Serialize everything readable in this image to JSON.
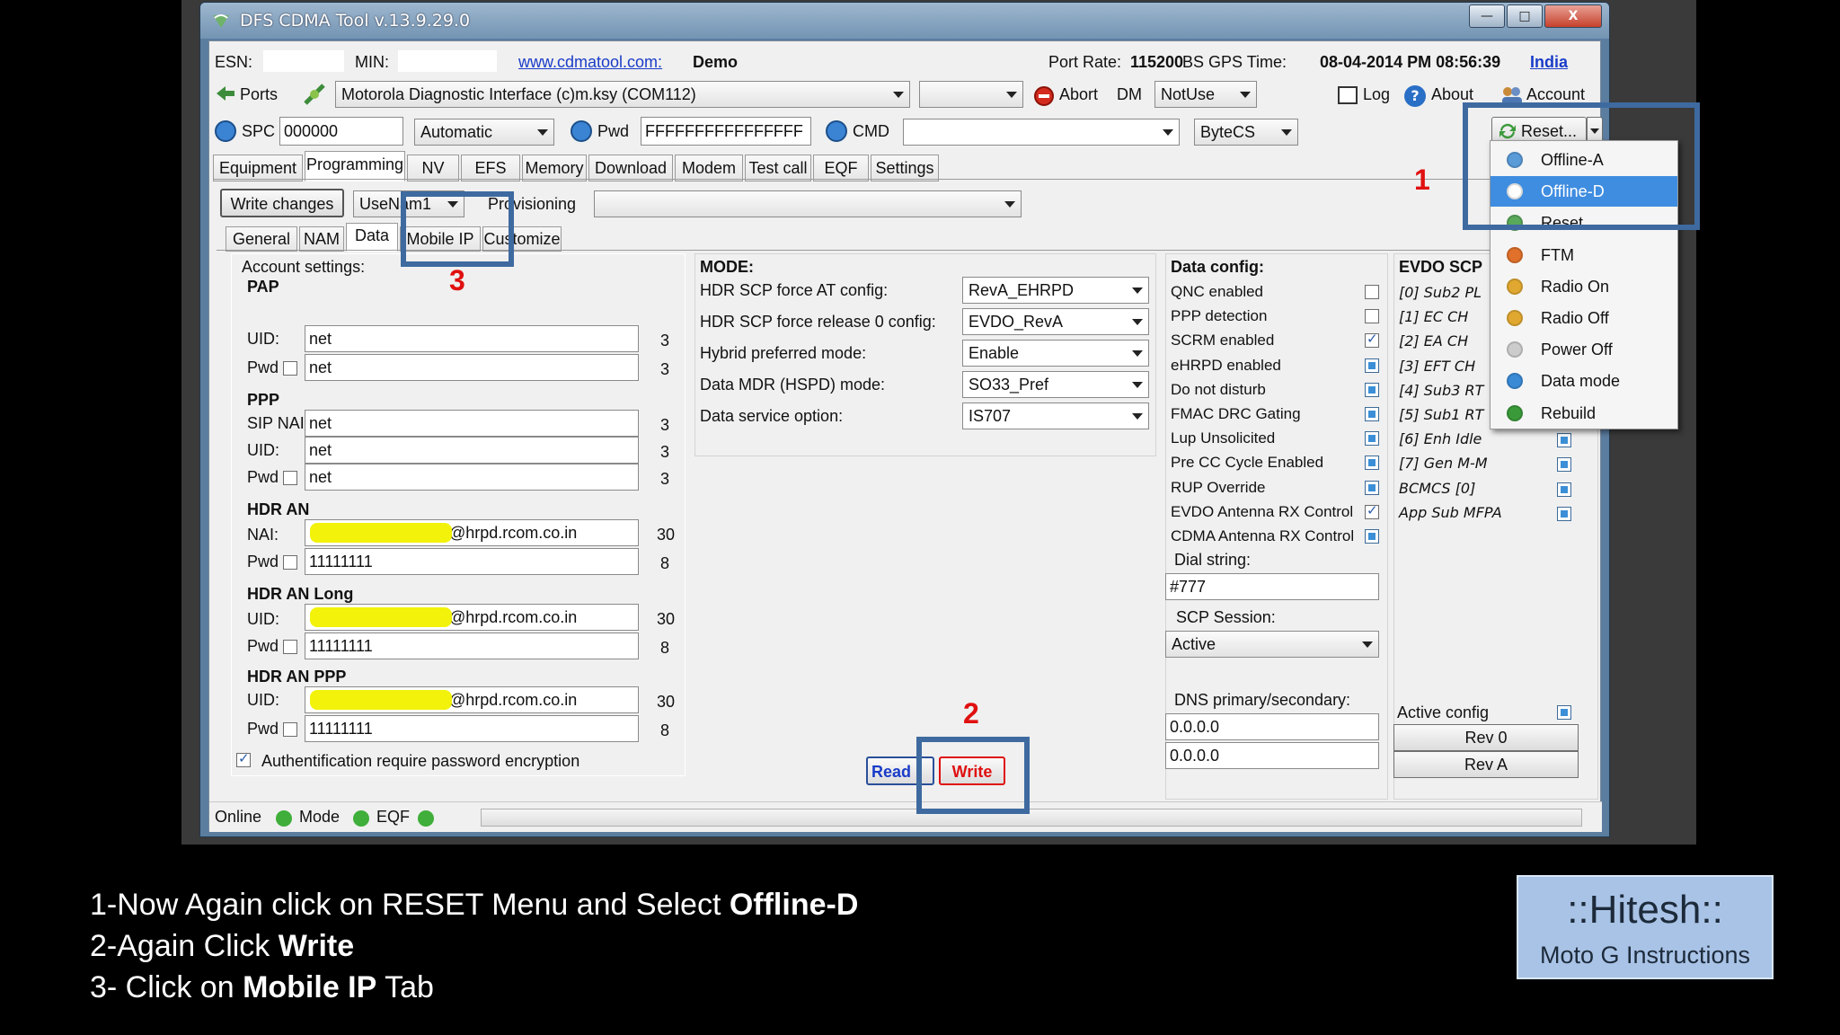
{
  "window": {
    "title": "DFS CDMA Tool v.13.9.29.0",
    "minimize": "—",
    "maximize": "□",
    "close": "X"
  },
  "info": {
    "esn_label": "ESN:",
    "esn_value": "",
    "min_label": "MIN:",
    "min_value": "",
    "link": "www.cdmatool.com:",
    "mode": "Demo",
    "port_rate_label": "Port Rate:",
    "port_rate": "115200",
    "gps_label": "BS GPS Time:",
    "gps_time": "08-04-2014 PM 08:56:39",
    "region": "India"
  },
  "toolbar1": {
    "ports": "Ports",
    "port_select": "Motorola Diagnostic Interface (c)m.ksy (COM112)",
    "second_select": "",
    "abort": "Abort",
    "dm_label": "DM",
    "dm_select": "NotUse",
    "log": "Log",
    "about": "About",
    "account": "Account"
  },
  "toolbar2": {
    "spc_label": "SPC",
    "spc_value": "000000",
    "spc_mode": "Automatic",
    "pwd_label": "Pwd",
    "pwd_value": "FFFFFFFFFFFFFFFF",
    "cmd_label": "CMD",
    "cmd_value": "",
    "bytecs": "ByteCS",
    "reset": "Reset..."
  },
  "main_tabs": [
    "Equipment",
    "Programming",
    "NV",
    "EFS",
    "Memory",
    "Download",
    "Modem",
    "Test call",
    "EQF",
    "Settings"
  ],
  "prog": {
    "write_changes": "Write changes",
    "usenam": "UseNam1",
    "provisioning_label": "Provisioning",
    "provisioning_value": ""
  },
  "sub_tabs": [
    "General",
    "NAM",
    "Data",
    "Mobile IP",
    "Customize"
  ],
  "account": {
    "heading": "Account settings:",
    "pap": {
      "title": "PAP",
      "uid_label": "UID:",
      "uid": "net",
      "uid_len": "3",
      "pwd_label": "Pwd",
      "pwd": "net",
      "pwd_len": "3"
    },
    "ppp": {
      "title": "PPP",
      "sip_label": "SIP NAI",
      "sip": "net",
      "sip_len": "3",
      "uid_label": "UID:",
      "uid": "net",
      "uid_len": "3",
      "pwd_label": "Pwd",
      "pwd": "net",
      "pwd_len": "3"
    },
    "hdr_an": {
      "title": "HDR AN",
      "nai_label": "NAI:",
      "nai": "@hrpd.rcom.co.in",
      "nai_len": "30",
      "pwd_label": "Pwd",
      "pwd": "11111111",
      "pwd_len": "8"
    },
    "hdr_an_long": {
      "title": "HDR AN Long",
      "uid_label": "UID:",
      "uid": "@hrpd.rcom.co.in",
      "uid_len": "30",
      "pwd_label": "Pwd",
      "pwd": "11111111",
      "pwd_len": "8"
    },
    "hdr_an_ppp": {
      "title": "HDR AN PPP",
      "uid_label": "UID:",
      "uid": "@hrpd.rcom.co.in",
      "uid_len": "30",
      "pwd_label": "Pwd",
      "pwd": "11111111",
      "pwd_len": "8"
    },
    "auth": "Authentification require password encryption"
  },
  "mode": {
    "title": "MODE:",
    "rows": [
      {
        "label": "HDR SCP force AT config:",
        "value": "RevA_EHRPD"
      },
      {
        "label": "HDR SCP force release 0 config:",
        "value": "EVDO_RevA"
      },
      {
        "label": "Hybrid preferred mode:",
        "value": "Enable"
      },
      {
        "label": "Data MDR (HSPD) mode:",
        "value": "SO33_Pref"
      },
      {
        "label": "Data service option:",
        "value": "IS707"
      }
    ],
    "read": "Read",
    "write": "Write"
  },
  "data_config": {
    "title": "Data config:",
    "items": [
      "QNC enabled",
      "PPP detection",
      "SCRM enabled",
      "eHRPD enabled",
      "Do not disturb",
      "FMAC DRC Gating",
      "Lup Unsolicited",
      "Pre CC Cycle Enabled",
      "RUP Override",
      "EVDO Antenna RX Control",
      "CDMA Antenna RX Control"
    ],
    "dial_label": "Dial string:",
    "dial_value": "#777",
    "scp_label": "SCP Session:",
    "scp_value": "Active",
    "dns_label": "DNS primary/secondary:",
    "dns1": "0.0.0.0",
    "dns2": "0.0.0.0"
  },
  "evdo": {
    "title": "EVDO SCP",
    "items": [
      "[0] Sub2 PL",
      "[1] EC CH",
      "[2] EA CH",
      "[3] EFT CH",
      "[4] Sub3 RT",
      "[5] Sub1 RT",
      "[6] Enh Idle",
      "[7] Gen M-M",
      "BCMCS [0]",
      "App Sub MFPA"
    ],
    "active_config": "Active config",
    "rev0": "Rev 0",
    "reva": "Rev A"
  },
  "reset_menu": [
    "Offline-A",
    "Offline-D",
    "Reset",
    "FTM",
    "Radio On",
    "Radio Off",
    "Power Off",
    "Data mode",
    "Rebuild"
  ],
  "status": {
    "online": "Online",
    "mode": "Mode",
    "eqf": "EQF"
  },
  "markers": {
    "one": "1",
    "two": "2",
    "three": "3"
  },
  "instructions": {
    "line1_prefix": "1-Now Again click on RESET Menu and Select ",
    "line1_bold": "Offline-D",
    "line2_prefix": "2-Again Click ",
    "line2_bold": "Write",
    "line3_prefix": "3- Click on ",
    "line3_bold": "Mobile IP",
    "line3_suffix": " Tab"
  },
  "badge": {
    "title": "::Hitesh::",
    "subtitle": "Moto G Instructions"
  }
}
